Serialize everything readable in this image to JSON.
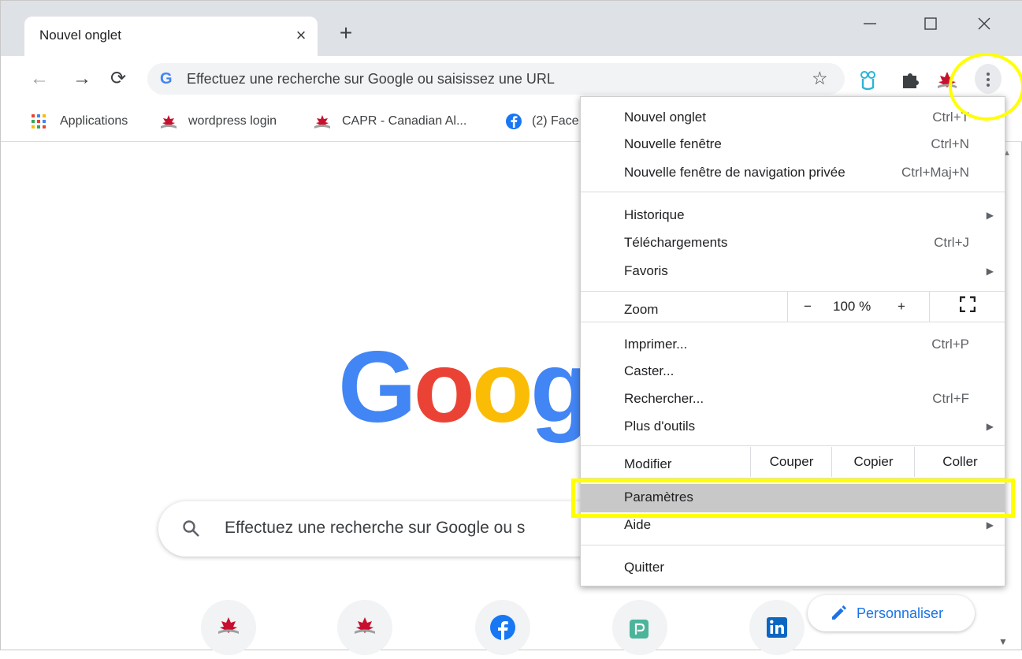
{
  "tab": {
    "title": "Nouvel onglet",
    "close_icon": "×",
    "new_tab_icon": "+"
  },
  "omnibox": {
    "google_letter": "G",
    "placeholder": "Effectuez une recherche sur Google ou saisissez une URL"
  },
  "bookmarks": [
    {
      "label": "Applications",
      "icon": "apps-grid-icon"
    },
    {
      "label": "wordpress login",
      "icon": "maple-leaf-icon"
    },
    {
      "label": "CAPR - Canadian Al...",
      "icon": "maple-leaf-icon"
    },
    {
      "label": "(2) Face",
      "icon": "facebook-icon"
    }
  ],
  "menu": {
    "new_tab": {
      "label": "Nouvel onglet",
      "shortcut": "Ctrl+T"
    },
    "new_window": {
      "label": "Nouvelle fenêtre",
      "shortcut": "Ctrl+N"
    },
    "incognito": {
      "label": "Nouvelle fenêtre de navigation privée",
      "shortcut": "Ctrl+Maj+N"
    },
    "history": {
      "label": "Historique"
    },
    "downloads": {
      "label": "Téléchargements",
      "shortcut": "Ctrl+J"
    },
    "bookmarks": {
      "label": "Favoris"
    },
    "zoom": {
      "label": "Zoom",
      "minus": "−",
      "value": "100 %",
      "plus": "+"
    },
    "print": {
      "label": "Imprimer...",
      "shortcut": "Ctrl+P"
    },
    "cast": {
      "label": "Caster..."
    },
    "find": {
      "label": "Rechercher...",
      "shortcut": "Ctrl+F"
    },
    "more_tools": {
      "label": "Plus d'outils"
    },
    "edit": {
      "label": "Modifier",
      "cut": "Couper",
      "copy": "Copier",
      "paste": "Coller"
    },
    "settings": {
      "label": "Paramètres"
    },
    "help": {
      "label": "Aide"
    },
    "quit": {
      "label": "Quitter"
    }
  },
  "page": {
    "logo_letters": [
      "G",
      "o",
      "o",
      "g"
    ],
    "logo_colors": [
      "#4285f4",
      "#ea4335",
      "#fbbc05",
      "#4285f4"
    ],
    "search_placeholder": "Effectuez une recherche sur Google ou s",
    "customize_label": "Personnaliser"
  },
  "colors": {
    "highlight": "#ffff00",
    "accent": "#1a73e8",
    "selected_item": "#c8c8c8"
  }
}
